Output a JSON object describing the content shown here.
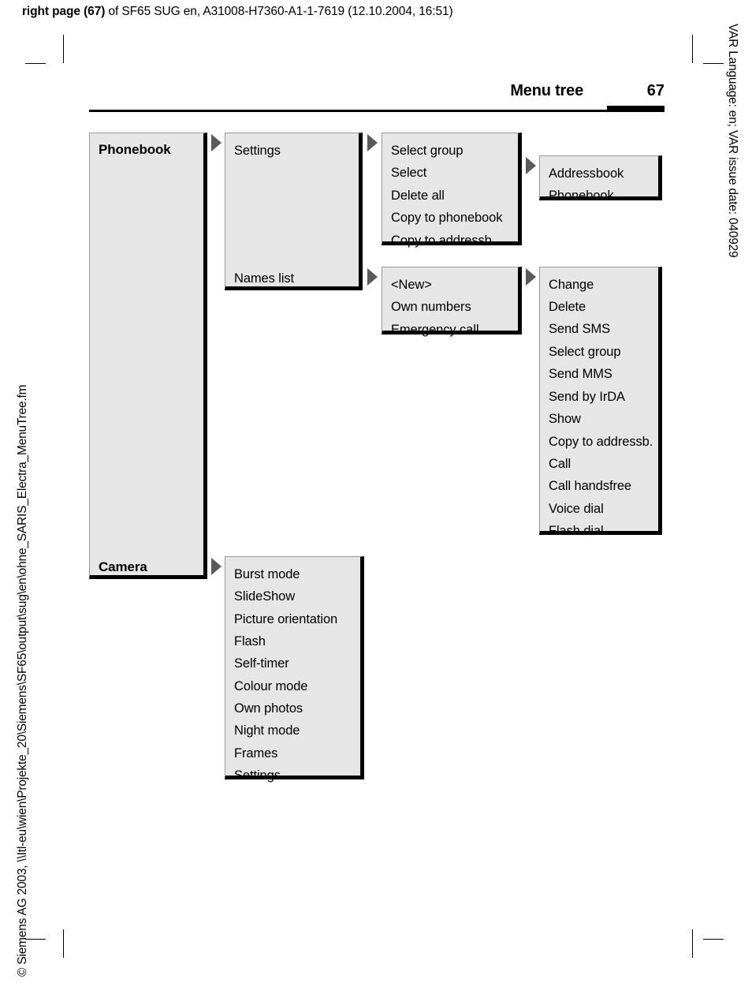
{
  "doc_header": {
    "bold_part": "right page (67)",
    "rest": " of SF65 SUG en, A31008-H7360-A1-1-7619 (12.10.2004, 16:51)"
  },
  "margins": {
    "left_footer": "© Siemens AG 2003, \\\\Itl-eu\\wien\\Projekte_20\\Siemens\\SF65\\output\\sug\\en\\ohne_SARIS_Electra_MenuTree.fm",
    "right_header": "VAR Language: en; VAR issue date: 040929"
  },
  "page_head": {
    "title": "Menu tree",
    "page_number": "67"
  },
  "menu_tree": {
    "level1": {
      "phonebook": "Phonebook",
      "camera": "Camera"
    },
    "phonebook_level2": {
      "settings": "Settings",
      "names_list": "Names list"
    },
    "settings_level3": [
      "Select group",
      "Select",
      "Delete all",
      "Copy to phonebook",
      "Copy to addressb."
    ],
    "settings_level4": [
      "Addressbook",
      "Phonebook"
    ],
    "names_list_level3": [
      "<New>",
      "Own numbers",
      "Emergency call"
    ],
    "names_list_level4": [
      "Change",
      "Delete",
      "Send SMS",
      "Select group",
      "Send MMS",
      "Send by IrDA",
      "Show",
      "Copy to addressb.",
      "Call",
      "Call handsfree",
      "Voice dial",
      "Flash dial"
    ],
    "camera_level2": [
      "Burst mode",
      "SlideShow",
      "Picture orientation",
      "Flash",
      "Self-timer",
      "Colour mode",
      "Own photos",
      "Night mode",
      "Frames",
      "Settings"
    ]
  }
}
